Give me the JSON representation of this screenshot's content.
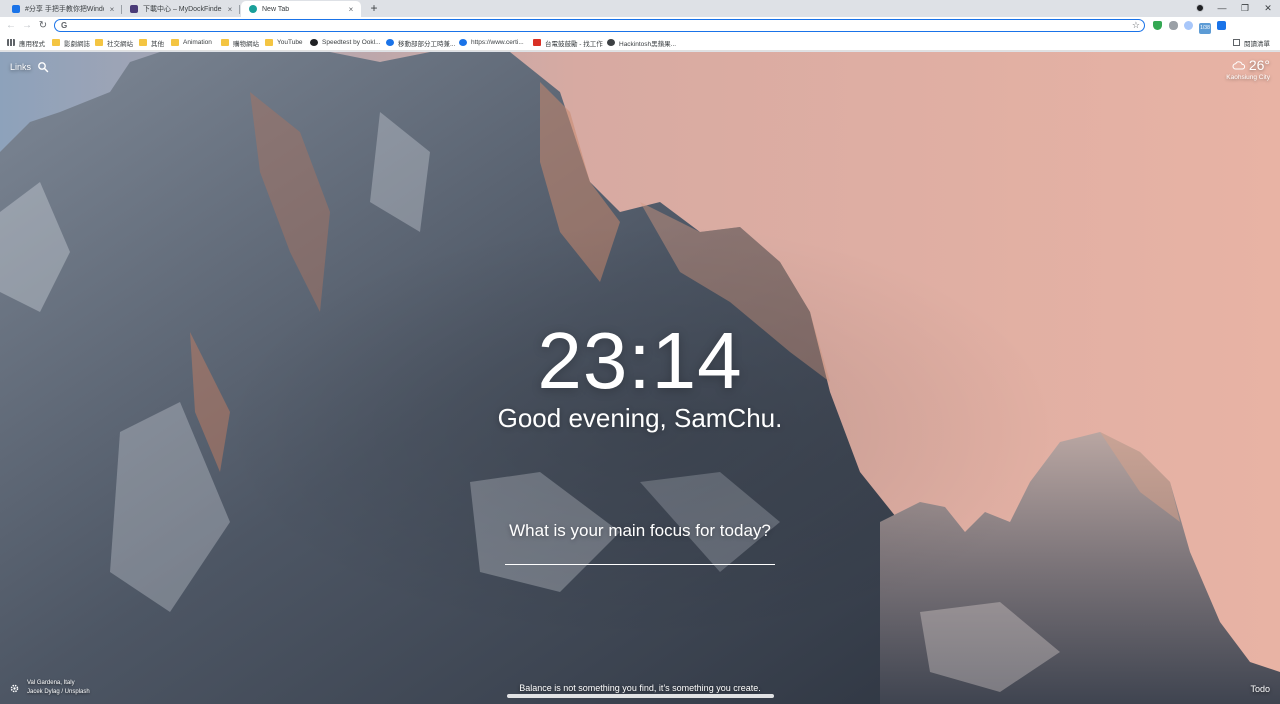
{
  "browser": {
    "tabs": [
      {
        "title": "#分享 手把手教你把Windows®...",
        "favicon_color": "#1a73e8",
        "active": false
      },
      {
        "title": "下載中心 – MyDockFinder",
        "favicon_color": "#4a3b78",
        "active": false
      },
      {
        "title": "New Tab",
        "favicon_color": "#1aa09a",
        "active": true
      }
    ],
    "tab_close_glyph": "×",
    "new_tab_glyph": "+",
    "window_controls": {
      "minimize": "—",
      "maximize": "❐",
      "close": "✕"
    },
    "nav": {
      "back": "←",
      "forward": "→",
      "reload": "↻"
    },
    "omnibox": {
      "engine_glyph": "G",
      "value": "",
      "placeholder": "",
      "star_glyph": "☆"
    },
    "extensions": [
      {
        "name": "shield-extension",
        "color": "#34a853"
      },
      {
        "name": "hand-extension",
        "color": "#9aa0a6"
      },
      {
        "name": "leaf-extension",
        "color": "#a8c7fa"
      },
      {
        "name": "blue-square-extension",
        "color": "#1a73e8"
      }
    ],
    "extension_badge": "1/38",
    "puzzle_glyph": "✱",
    "menu_glyph": "⋮"
  },
  "bookmarks": {
    "items": [
      {
        "label": "應用程式",
        "icon": "grid"
      },
      {
        "label": "影劇網誌",
        "icon": "folder"
      },
      {
        "label": "社交網站",
        "icon": "folder"
      },
      {
        "label": "其他",
        "icon": "folder"
      },
      {
        "label": "Animation",
        "icon": "folder"
      },
      {
        "label": "購物網站",
        "icon": "folder"
      },
      {
        "label": "YouTube",
        "icon": "folder"
      },
      {
        "label": "Speedtest by Ookl...",
        "icon": "circle-dark"
      },
      {
        "label": "移動部部分工時兼...",
        "icon": "circle-blue"
      },
      {
        "label": "https://www.certi...",
        "icon": "circle-blue"
      },
      {
        "label": "台電鼓鼓勵 - 找工作",
        "icon": "red"
      },
      {
        "label": "Hackintosh黑蘋果...",
        "icon": "circle-dark"
      }
    ],
    "reading_list": "閱讀清單"
  },
  "momentum": {
    "links_label": "Links",
    "weather": {
      "temperature": "26°",
      "location": "Kaohsiung City"
    },
    "clock": "23:14",
    "greeting": "Good evening, SamChu.",
    "focus_question": "What is your main focus for today?",
    "focus_value": "",
    "photo": {
      "location": "Val Gardena, Italy",
      "credit": "Jacek Dylag / Unsplash"
    },
    "quote": "Balance is not something you find, it’s something you create.",
    "todo_label": "Todo"
  }
}
